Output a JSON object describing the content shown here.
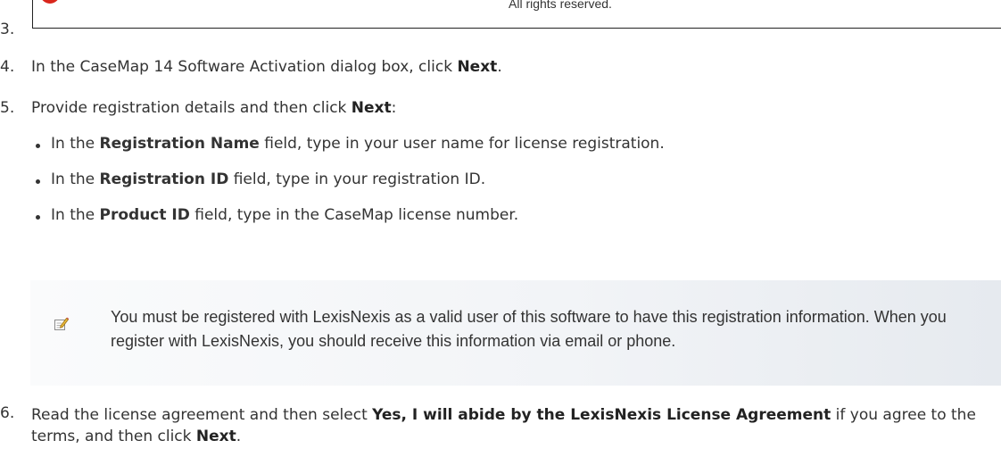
{
  "screenshot_fragment": {
    "rights_text": "All rights reserved."
  },
  "steps": [
    {
      "number": "3."
    },
    {
      "number": "4.",
      "parts": [
        "In the CaseMap 14 Software Activation dialog box, click ",
        "Next",
        "."
      ]
    },
    {
      "number": "5.",
      "parts": [
        "Provide registration details and then click ",
        "Next",
        ":"
      ],
      "bullets": [
        {
          "parts": [
            "In the ",
            "Registration Name",
            " field, type in your user name for license registration."
          ]
        },
        {
          "parts": [
            "In the ",
            "Registration ID",
            " field, type in your registration ID."
          ]
        },
        {
          "parts": [
            "In the ",
            "Product ID",
            " field, type in the CaseMap license number."
          ]
        }
      ]
    },
    {
      "number": "6.",
      "parts": [
        "Read the license agreement and then select  ",
        "Yes, I will abide by the LexisNexis License Agreement",
        " if you agree to the terms, and then click ",
        "Next",
        "."
      ]
    }
  ],
  "note": {
    "icon": "note-edit-icon",
    "text": "You must be registered with LexisNexis as a valid user of this software to have this registration information. When you register with LexisNexis, you should receive this information via email or phone."
  }
}
